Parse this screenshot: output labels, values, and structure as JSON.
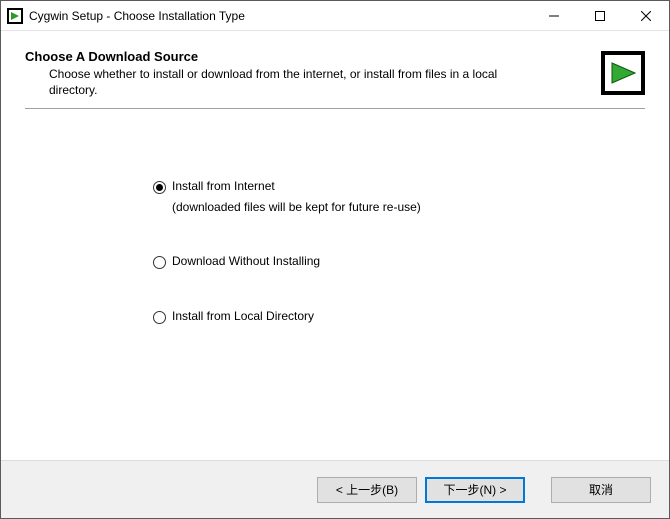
{
  "window": {
    "title": "Cygwin Setup - Choose Installation Type"
  },
  "header": {
    "heading": "Choose A Download Source",
    "subheading": "Choose whether to install or download from the internet, or install from files in a local directory."
  },
  "options": {
    "opt1": {
      "label": "Install from Internet",
      "sublabel": "(downloaded files will be kept for future re-use)",
      "selected": true
    },
    "opt2": {
      "label": "Download Without Installing",
      "selected": false
    },
    "opt3": {
      "label": "Install from Local Directory",
      "selected": false
    }
  },
  "buttons": {
    "back": "< 上一步(B)",
    "next": "下一步(N) >",
    "cancel": "取消"
  }
}
